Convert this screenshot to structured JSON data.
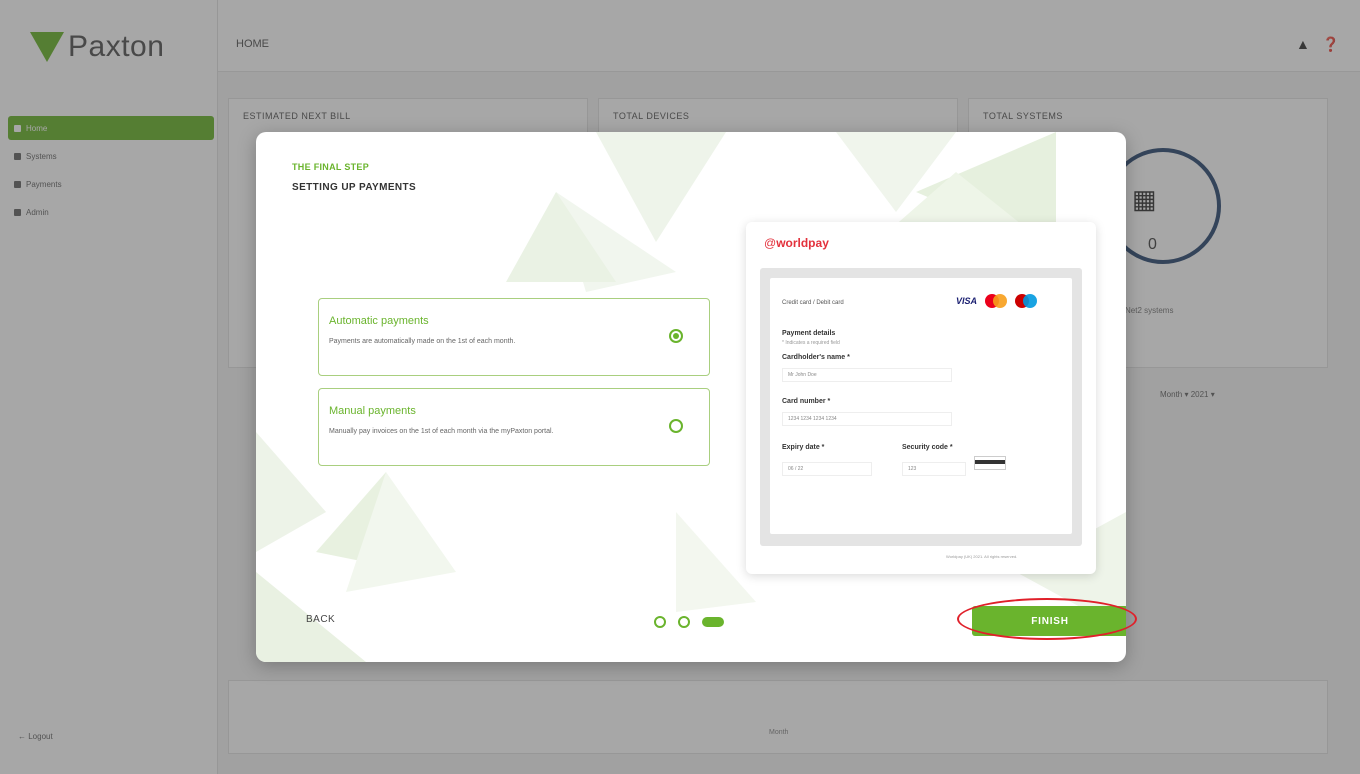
{
  "app": {
    "logo_text": "Paxton",
    "page_title": "HOME",
    "nav": [
      "Home",
      "Systems",
      "Payments",
      "Admin"
    ],
    "logout": "← Logout",
    "cards": [
      "ESTIMATED NEXT BILL",
      "TOTAL DEVICES",
      "TOTAL SYSTEMS"
    ],
    "systems_count": "0",
    "systems_label": "Net2 systems",
    "selectors": "Month ▾  2021 ▾",
    "months": [
      "",
      "",
      "",
      "",
      "",
      "",
      "",
      "",
      "",
      "",
      "",
      "",
      ""
    ],
    "axis_caption": "Month",
    "icons": {
      "bell": "bell-icon",
      "help": "help-icon"
    }
  },
  "modal": {
    "step_label": "THE FINAL STEP",
    "step_title": "SETTING UP PAYMENTS",
    "options": [
      {
        "title": "Automatic payments",
        "desc": "Payments are automatically made on the 1st of each month.",
        "checked": true
      },
      {
        "title": "Manual payments",
        "desc": "Manually pay invoices on the 1st of each month via the myPaxton portal.",
        "checked": false
      }
    ],
    "worldpay": {
      "brand_a": "worldpay",
      "brand_prefix": "@",
      "card_type_label": "Credit card / Debit card",
      "visa": "VISA",
      "details_label": "Payment details",
      "details_sub": "* Indicates a required field",
      "holder_label": "Cardholder's name *",
      "holder_value": "Mr John Doe",
      "number_label": "Card number *",
      "number_value": "1234 1234 1234 1234",
      "expiry_label": "Expiry date *",
      "expiry_value": "06 / 22",
      "security_label": "Security code *",
      "security_value": "123",
      "footer": "Worldpay (UK) 2021. All rights reserved."
    },
    "back": "BACK",
    "finish": "FINISH",
    "steps": 3,
    "active_step": 3
  },
  "colors": {
    "accent": "#6ab42d",
    "highlight": "#e0202a",
    "navy": "#2f4b73"
  }
}
